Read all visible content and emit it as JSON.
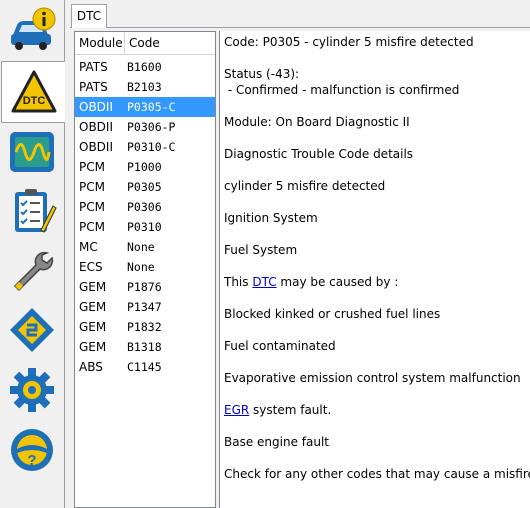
{
  "sidebar": {
    "items": [
      {
        "name": "vehicle-info",
        "icon": "car-info-icon"
      },
      {
        "name": "dtc",
        "icon": "dtc-warning-icon",
        "label": "DTC",
        "active": true
      },
      {
        "name": "oscilloscope",
        "icon": "oscilloscope-icon"
      },
      {
        "name": "checklist",
        "icon": "clipboard-checklist-icon"
      },
      {
        "name": "service",
        "icon": "wrench-icon"
      },
      {
        "name": "ecu",
        "icon": "chip-icon"
      },
      {
        "name": "settings",
        "icon": "gear-icon"
      },
      {
        "name": "help",
        "icon": "steering-help-icon"
      }
    ]
  },
  "tabs": [
    {
      "label": "DTC"
    }
  ],
  "list": {
    "headers": {
      "module": "Module",
      "code": "Code"
    },
    "rows": [
      {
        "module": "PATS",
        "code": "B1600"
      },
      {
        "module": "PATS",
        "code": "B2103"
      },
      {
        "module": "OBDII",
        "code": "P0305-C",
        "selected": true
      },
      {
        "module": "OBDII",
        "code": "P0306-P"
      },
      {
        "module": "OBDII",
        "code": "P0310-C"
      },
      {
        "module": "PCM",
        "code": "P1000"
      },
      {
        "module": "PCM",
        "code": "P0305"
      },
      {
        "module": "PCM",
        "code": "P0306"
      },
      {
        "module": "PCM",
        "code": "P0310"
      },
      {
        "module": "MC",
        "code": "None"
      },
      {
        "module": "ECS",
        "code": "None"
      },
      {
        "module": "GEM",
        "code": "P1876"
      },
      {
        "module": "GEM",
        "code": "P1347"
      },
      {
        "module": "GEM",
        "code": "P1832"
      },
      {
        "module": "GEM",
        "code": "B1318"
      },
      {
        "module": "ABS",
        "code": "C1145"
      }
    ]
  },
  "details": {
    "code_line": "Code: P0305 - cylinder 5 misfire detected",
    "status_line": "Status (-43):",
    "status_detail": " - Confirmed - malfunction is confirmed",
    "module_line": "Module: On Board Diagnostic II",
    "section_title": "Diagnostic Trouble Code details",
    "description": "cylinder 5 misfire detected",
    "system1": "Ignition System",
    "system2": "Fuel System",
    "cause_prefix": "This ",
    "cause_link": "DTC",
    "cause_suffix": " may be caused by :",
    "cause1": "Blocked kinked or crushed fuel lines",
    "cause2": "Fuel contaminated",
    "cause3": "Evaporative emission control system malfunction",
    "cause4_link": "EGR",
    "cause4_suffix": " system fault.",
    "cause5": "Base engine fault",
    "advice": "Check for any other codes that may cause a misfire."
  },
  "colors": {
    "selection": "#3399ff",
    "link": "#0000cc",
    "icon_blue": "#1e6fb8",
    "icon_yellow": "#f2c500"
  }
}
